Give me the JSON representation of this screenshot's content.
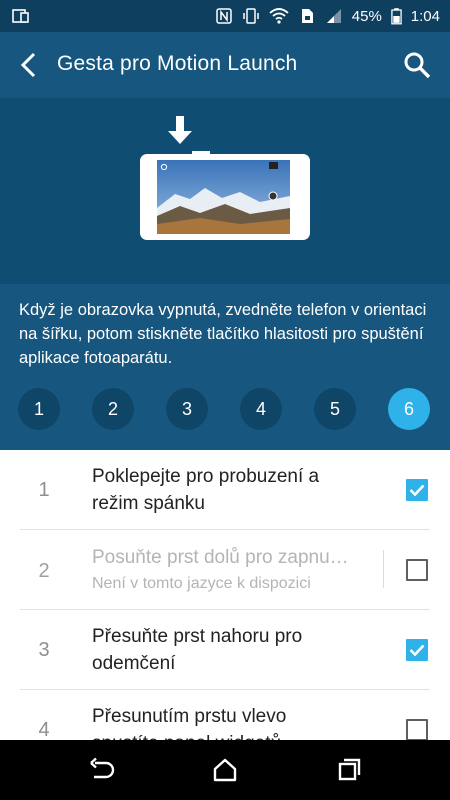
{
  "status_bar": {
    "battery_percent": "45%",
    "time": "1:04",
    "icons": [
      "screen-mirror-icon",
      "nfc-icon",
      "vibrate-icon",
      "wifi-icon",
      "sim-icon",
      "signal-icon",
      "battery-icon"
    ]
  },
  "app_bar": {
    "title": "Gesta pro Motion Launch",
    "back_icon": "back-arrow-icon",
    "search_icon": "search-icon"
  },
  "hero": {
    "illustration": "phone-landscape-camera-illustration",
    "arrow_icon": "down-arrow-icon"
  },
  "description": "Když je obrazovka vypnutá, zvedněte telefon v orientaci na šířku, potom stiskněte tlačítko hlasitosti pro spuštění aplikace fotoaparátu.",
  "steps": {
    "items": [
      "1",
      "2",
      "3",
      "4",
      "5",
      "6"
    ],
    "active_index": 5
  },
  "gestures": [
    {
      "number": "1",
      "title_line1": "Poklepejte pro probuzení a",
      "title_line2": "režim spánku",
      "checked": true,
      "enabled": true
    },
    {
      "number": "2",
      "title": "Posuňte prst dolů pro zapnu…",
      "subtitle": "Není v tomto jazyce k dispozici",
      "checked": false,
      "enabled": false
    },
    {
      "number": "3",
      "title_line1": "Přesuňte prst nahoru pro",
      "title_line2": "odemčení",
      "checked": true,
      "enabled": true
    },
    {
      "number": "4",
      "title_line1": "Přesunutím prstu vlevo",
      "title_line2": "spustíte panel widgetů",
      "checked": false,
      "enabled": true
    }
  ],
  "nav_bar": {
    "icons": [
      "nav-back-icon",
      "nav-home-icon",
      "nav-recents-icon"
    ]
  },
  "colors": {
    "accent": "#2fb1ea",
    "app_bar": "#17567e",
    "status_bar": "#0f3f5e",
    "hero_bg": "#0f4d73"
  }
}
